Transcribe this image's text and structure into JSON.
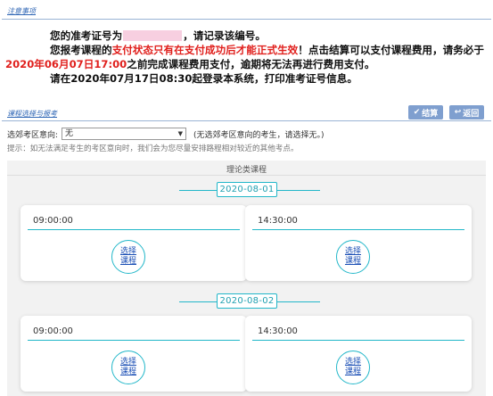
{
  "notice": {
    "title": "注意事项",
    "line1_prefix": "您的准考证号为",
    "line1_suffix": "，请记录该编号。",
    "line2_prefix": "您报考课程的",
    "line2_red": "支付状态只有在支付成功后才能正式生效",
    "line2_suffix": "！点击结算可以支付课程费用，请务必于",
    "line3_red": "2020年06月07日17:00",
    "line3_suffix": "之前完成课程费用支付，逾期将无法再进行费用支付。",
    "line4": "请在2020年07月17日08:30起登录本系统，打印准考证号信息。"
  },
  "selection": {
    "title": "课程选择与报考",
    "checkout_label": "结算",
    "back_label": "返回",
    "region_label": "选郊考区意向:",
    "region_value": "无",
    "region_hint": "(无选郊考区意向的考生，请选择无。)",
    "tip": "提示：如无法满足考生的考区意向时，我们会为您尽量安排路程相对较近的其他考点。"
  },
  "courses": {
    "category": "理论类课程",
    "dates": [
      {
        "date": "2020-08-01",
        "slots": [
          {
            "time": "09:00:00",
            "action_line1": "选择",
            "action_line2": "课程"
          },
          {
            "time": "14:30:00",
            "action_line1": "选择",
            "action_line2": "课程"
          }
        ]
      },
      {
        "date": "2020-08-02",
        "slots": [
          {
            "time": "09:00:00",
            "action_line1": "选择",
            "action_line2": "课程"
          },
          {
            "time": "14:30:00",
            "action_line1": "选择",
            "action_line2": "课程"
          }
        ]
      }
    ]
  },
  "colors": {
    "accent": "#22b7c9",
    "alert": "#e0201d",
    "button": "#7f9fcf",
    "link": "#1b4fb5"
  },
  "icons": {
    "checkout": "check-icon",
    "back": "return-arrow-icon",
    "select": "chevron-down-icon"
  }
}
